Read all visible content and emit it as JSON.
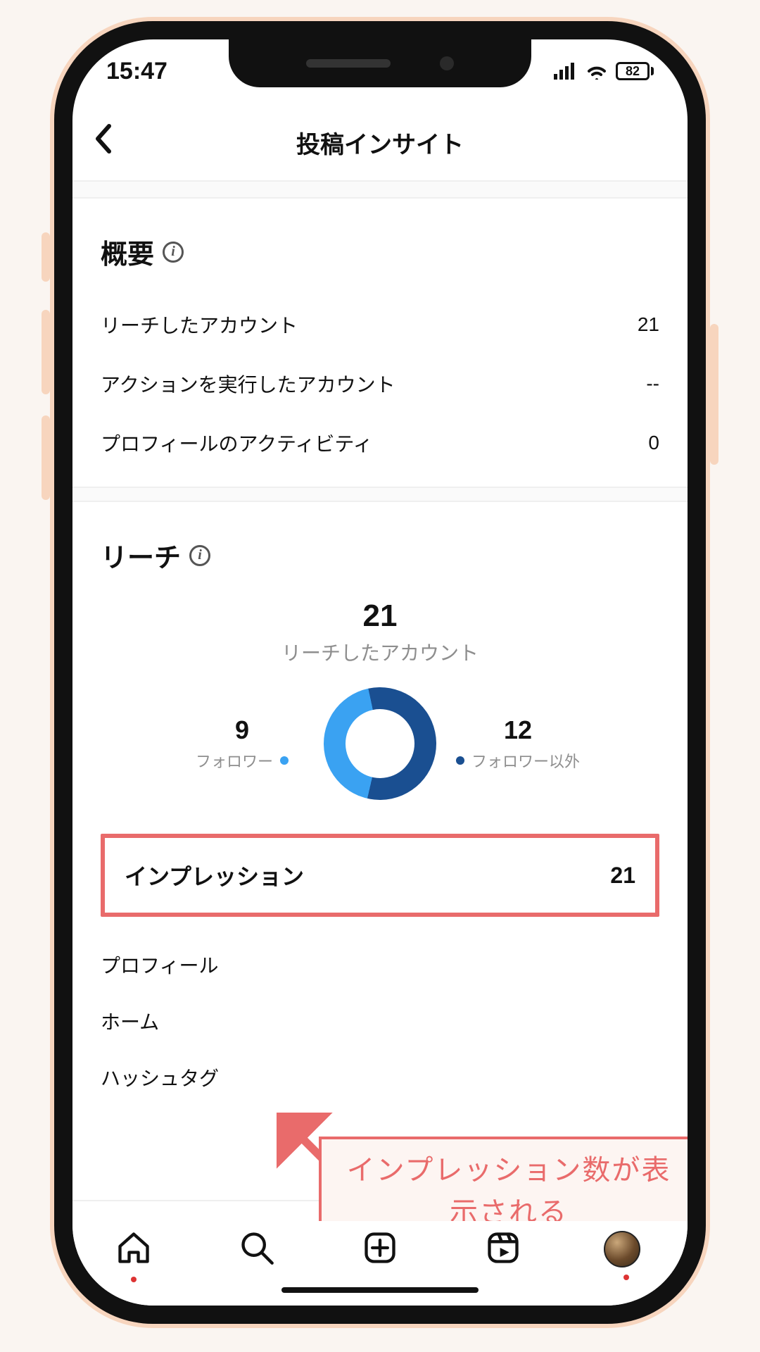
{
  "status": {
    "time": "15:47",
    "battery": "82"
  },
  "nav": {
    "title": "投稿インサイト"
  },
  "overview": {
    "title": "概要",
    "rows": [
      {
        "label": "リーチしたアカウント",
        "value": "21"
      },
      {
        "label": "アクションを実行したアカウント",
        "value": "--"
      },
      {
        "label": "プロフィールのアクティビティ",
        "value": "0"
      }
    ]
  },
  "reach": {
    "title": "リーチ",
    "total": "21",
    "total_label": "リーチしたアカウント",
    "followers": {
      "value": "9",
      "label": "フォロワー"
    },
    "nonfollowers": {
      "value": "12",
      "label": "フォロワー以外"
    }
  },
  "impressions": {
    "label": "インプレッション",
    "value": "21",
    "sub_items": [
      "プロフィール",
      "ホーム",
      "ハッシュタグ"
    ]
  },
  "annotation": {
    "text": "インプレッション数が表示される"
  },
  "chart_data": {
    "type": "pie",
    "title": "リーチしたアカウント",
    "series": [
      {
        "name": "フォロワー",
        "value": 9,
        "color": "#3aa2f2"
      },
      {
        "name": "フォロワー以外",
        "value": 12,
        "color": "#1a4f91"
      }
    ],
    "total": 21
  },
  "tabbar": {
    "items": [
      "home",
      "search",
      "create",
      "reels",
      "profile"
    ]
  }
}
